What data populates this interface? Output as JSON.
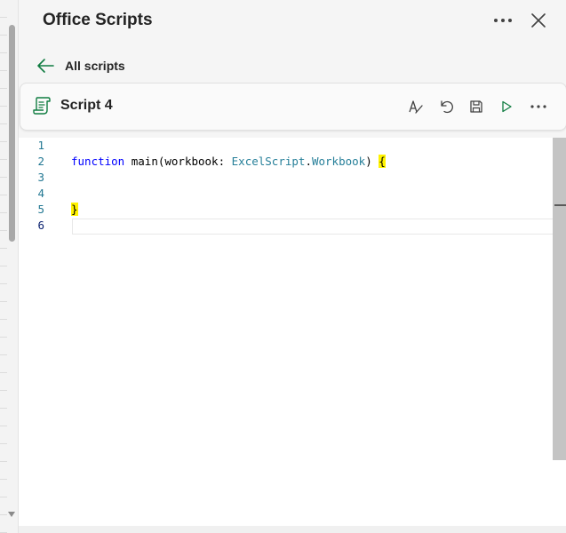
{
  "pane": {
    "title": "Office Scripts",
    "back_label": "All scripts"
  },
  "script": {
    "name": "Script 4"
  },
  "editor": {
    "line_numbers": [
      "1",
      "2",
      "3",
      "4",
      "5",
      "6"
    ],
    "lines": {
      "l2": {
        "keyword": "function",
        "text1": " main(workbook: ",
        "type1": "ExcelScript",
        "dot": ".",
        "type2": "Workbook",
        "text2": ") ",
        "brace_open": "{"
      },
      "l5": {
        "brace_close": "}"
      }
    }
  },
  "icons": {
    "more": "more-horizontal-icon",
    "close": "close-icon",
    "back": "arrow-left-icon",
    "script": "script-document-icon",
    "spellcheck": "text-proofing-icon",
    "undo": "undo-icon",
    "save": "save-icon",
    "run": "play-icon",
    "script_more": "more-horizontal-icon"
  },
  "colors": {
    "accent_green": "#107c41",
    "keyword": "#0000ff",
    "type": "#267f99",
    "line_number": "#237893",
    "bracket_highlight": "#fff200"
  }
}
